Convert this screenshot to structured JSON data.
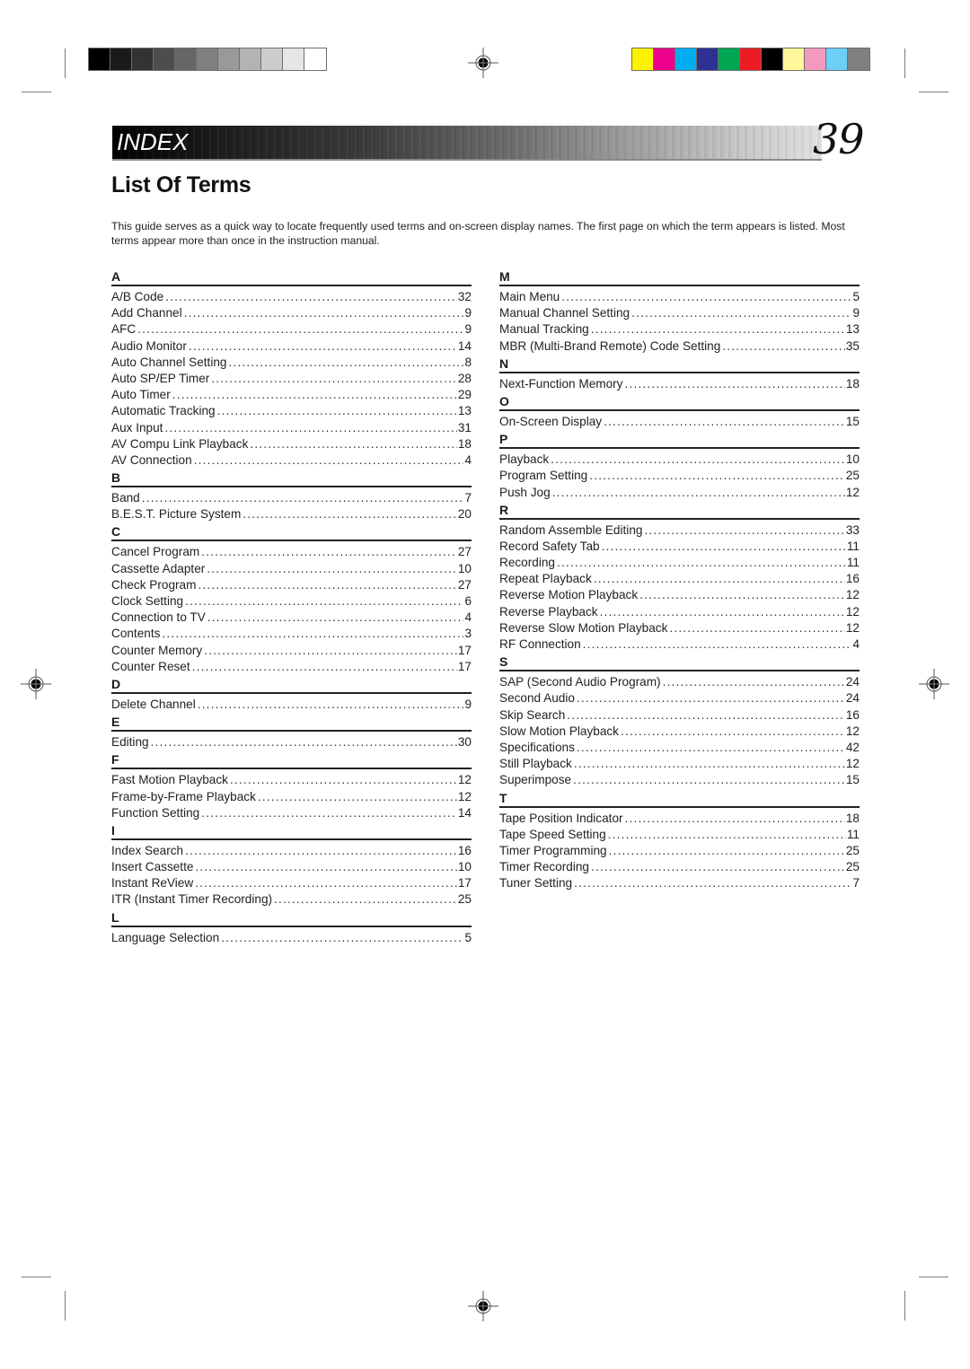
{
  "header": {
    "section_label": "INDEX",
    "page_number": "39"
  },
  "title": "List Of Terms",
  "intro": "This guide serves as a quick way to locate frequently used terms and on-screen display names. The first page on which the term appears is listed. Most terms appear more than once in the instruction manual.",
  "print_marks": {
    "gray_swatches": [
      "#000000",
      "#1a1a1a",
      "#333333",
      "#4d4d4d",
      "#666666",
      "#808080",
      "#999999",
      "#b3b3b3",
      "#cccccc",
      "#e6e6e6",
      "#ffffff"
    ],
    "color_swatches": [
      "#fff200",
      "#ec008c",
      "#00aeef",
      "#2e3192",
      "#00a651",
      "#ed1c24",
      "#000000",
      "#fff799",
      "#f49ac1",
      "#6dcff6",
      "#808080"
    ]
  },
  "left_column": [
    {
      "letter": "A",
      "entries": [
        {
          "term": "A/B Code",
          "page": "32"
        },
        {
          "term": "Add Channel",
          "page": "9"
        },
        {
          "term": "AFC",
          "page": "9"
        },
        {
          "term": "Audio Monitor",
          "page": "14"
        },
        {
          "term": "Auto Channel Setting",
          "page": "8"
        },
        {
          "term": "Auto SP/EP Timer",
          "page": "28"
        },
        {
          "term": "Auto Timer",
          "page": "29"
        },
        {
          "term": "Automatic Tracking",
          "page": "13"
        },
        {
          "term": "Aux Input",
          "page": "31"
        },
        {
          "term": "AV Compu Link Playback",
          "page": "18"
        },
        {
          "term": "AV Connection",
          "page": "4"
        }
      ]
    },
    {
      "letter": "B",
      "entries": [
        {
          "term": "Band",
          "page": "7"
        },
        {
          "term": "B.E.S.T. Picture System",
          "page": "20"
        }
      ]
    },
    {
      "letter": "C",
      "entries": [
        {
          "term": "Cancel Program",
          "page": "27"
        },
        {
          "term": "Cassette Adapter",
          "page": "10"
        },
        {
          "term": "Check Program",
          "page": "27"
        },
        {
          "term": "Clock Setting",
          "page": "6"
        },
        {
          "term": "Connection to TV",
          "page": "4"
        },
        {
          "term": "Contents",
          "page": "3"
        },
        {
          "term": "Counter Memory",
          "page": "17"
        },
        {
          "term": "Counter Reset",
          "page": "17"
        }
      ]
    },
    {
      "letter": "D",
      "entries": [
        {
          "term": "Delete Channel",
          "page": "9"
        }
      ]
    },
    {
      "letter": "E",
      "entries": [
        {
          "term": "Editing",
          "page": "30"
        }
      ]
    },
    {
      "letter": "F",
      "entries": [
        {
          "term": "Fast Motion Playback",
          "page": "12"
        },
        {
          "term": "Frame-by-Frame Playback",
          "page": "12"
        },
        {
          "term": "Function Setting",
          "page": "14"
        }
      ]
    },
    {
      "letter": "I",
      "entries": [
        {
          "term": "Index Search",
          "page": "16"
        },
        {
          "term": "Insert Cassette",
          "page": "10"
        },
        {
          "term": "Instant ReView",
          "page": "17"
        },
        {
          "term": "ITR (Instant Timer Recording)",
          "page": "25"
        }
      ]
    },
    {
      "letter": "L",
      "entries": [
        {
          "term": "Language Selection",
          "page": "5"
        }
      ]
    }
  ],
  "right_column": [
    {
      "letter": "M",
      "entries": [
        {
          "term": "Main Menu",
          "page": "5"
        },
        {
          "term": "Manual Channel Setting",
          "page": "9"
        },
        {
          "term": "Manual Tracking",
          "page": "13"
        },
        {
          "term": "MBR (Multi-Brand Remote) Code Setting",
          "page": "35"
        }
      ]
    },
    {
      "letter": "N",
      "entries": [
        {
          "term": "Next-Function Memory",
          "page": "18"
        }
      ]
    },
    {
      "letter": "O",
      "entries": [
        {
          "term": "On-Screen Display",
          "page": "15"
        }
      ]
    },
    {
      "letter": "P",
      "entries": [
        {
          "term": "Playback",
          "page": "10"
        },
        {
          "term": "Program Setting",
          "page": "25"
        },
        {
          "term": "Push Jog",
          "page": "12"
        }
      ]
    },
    {
      "letter": "R",
      "entries": [
        {
          "term": "Random Assemble Editing",
          "page": "33"
        },
        {
          "term": "Record Safety Tab",
          "page": "11"
        },
        {
          "term": "Recording",
          "page": "11"
        },
        {
          "term": "Repeat Playback",
          "page": "16"
        },
        {
          "term": "Reverse Motion Playback",
          "page": "12"
        },
        {
          "term": "Reverse Playback",
          "page": "12"
        },
        {
          "term": "Reverse Slow Motion Playback",
          "page": "12"
        },
        {
          "term": "RF Connection",
          "page": "4"
        }
      ]
    },
    {
      "letter": "S",
      "entries": [
        {
          "term": "SAP (Second Audio Program)",
          "page": "24"
        },
        {
          "term": "Second Audio",
          "page": "24"
        },
        {
          "term": "Skip Search",
          "page": "16"
        },
        {
          "term": "Slow Motion Playback",
          "page": "12"
        },
        {
          "term": "Specifications",
          "page": "42"
        },
        {
          "term": "Still Playback",
          "page": "12"
        },
        {
          "term": "Superimpose",
          "page": "15"
        }
      ]
    },
    {
      "letter": "T",
      "entries": [
        {
          "term": "Tape Position Indicator",
          "page": "18"
        },
        {
          "term": "Tape Speed Setting",
          "page": "11"
        },
        {
          "term": "Timer Programming",
          "page": "25"
        },
        {
          "term": "Timer Recording",
          "page": "25"
        },
        {
          "term": "Tuner Setting",
          "page": "7"
        }
      ]
    }
  ]
}
